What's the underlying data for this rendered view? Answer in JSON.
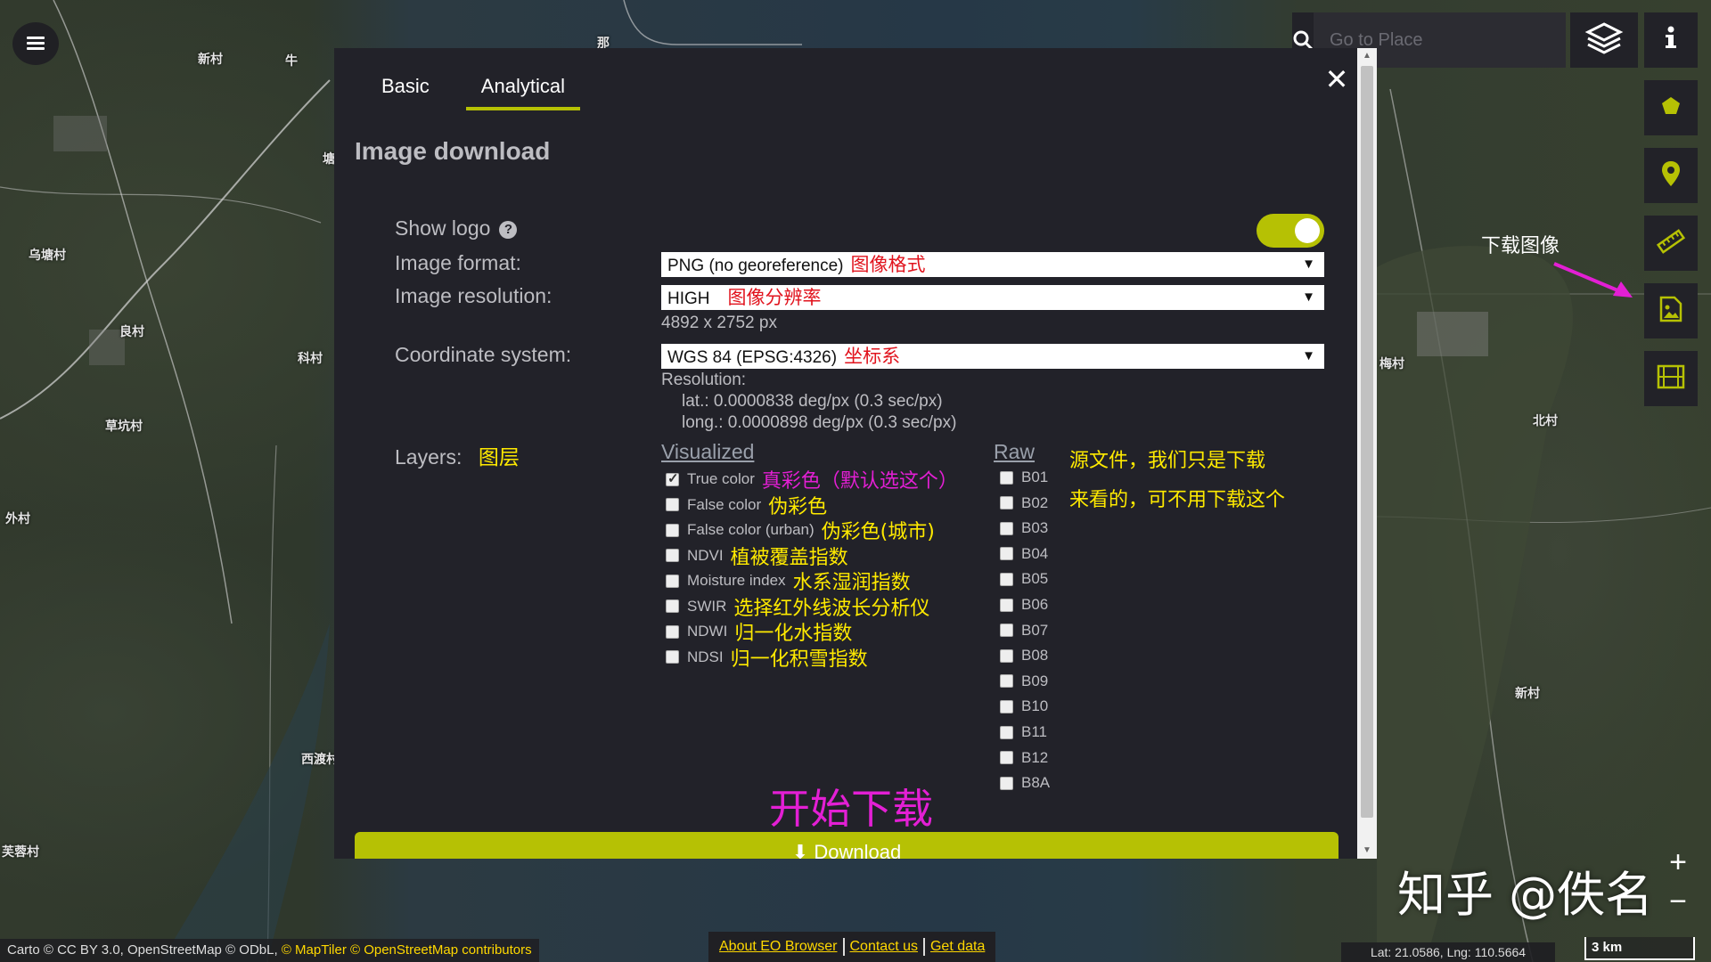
{
  "map": {
    "places": [
      "新村",
      "牛",
      "那",
      "塘",
      "北村",
      "新村",
      "乌塘村",
      "良村",
      "科村",
      "草坑村",
      "外村",
      "西渡村",
      "芙蓉村",
      "梅村"
    ]
  },
  "search": {
    "placeholder": "Go to Place"
  },
  "modal": {
    "tabs": [
      "Basic",
      "Analytical"
    ],
    "active_tab": "Analytical",
    "title": "Image download",
    "show_logo_label": "Show logo",
    "show_logo_enabled": true,
    "image_format_label": "Image format:",
    "image_format_value": "PNG (no georeference)",
    "image_format_note": "图像格式",
    "image_resolution_label": "Image resolution:",
    "image_resolution_value": "HIGH",
    "image_resolution_note": "图像分辨率",
    "image_size": "4892 x 2752 px",
    "coordinate_system_label": "Coordinate system:",
    "coordinate_system_value": "WGS 84 (EPSG:4326)",
    "coordinate_system_note": "坐标系",
    "resolution_label": "Resolution:",
    "resolution_lat": "lat.: 0.0000838 deg/px (0.3 sec/px)",
    "resolution_long": "long.: 0.0000898 deg/px (0.3 sec/px)",
    "layers_label": "Layers:",
    "layers_note": "图层",
    "visualized_header": "Visualized",
    "raw_header": "Raw",
    "visualized": [
      {
        "label": "True color",
        "note": "真彩色（默认选这个）",
        "checked": true,
        "note_color": "#e31fd4"
      },
      {
        "label": "False color",
        "note": "伪彩色",
        "checked": false,
        "note_color": "#ffea00"
      },
      {
        "label": "False color (urban)",
        "note": "伪彩色(城市)",
        "checked": false,
        "note_color": "#ffea00"
      },
      {
        "label": "NDVI",
        "note": "植被覆盖指数",
        "checked": false,
        "note_color": "#ffea00"
      },
      {
        "label": "Moisture index",
        "note": "水系湿润指数",
        "checked": false,
        "note_color": "#ffea00"
      },
      {
        "label": "SWIR",
        "note": "选择红外线波长分析仪",
        "checked": false,
        "note_color": "#ffea00"
      },
      {
        "label": "NDWI",
        "note": "归一化水指数",
        "checked": false,
        "note_color": "#ffea00"
      },
      {
        "label": "NDSI",
        "note": "归一化积雪指数",
        "checked": false,
        "note_color": "#ffea00"
      }
    ],
    "raw": [
      "B01",
      "B02",
      "B03",
      "B04",
      "B05",
      "B06",
      "B07",
      "B08",
      "B09",
      "B10",
      "B11",
      "B12",
      "B8A"
    ],
    "raw_note_line1": "源文件，我们只是下载",
    "raw_note_line2": "来看的，可不用下载这个",
    "start_download_note": "开始下载",
    "download_button": "Download"
  },
  "annotations": {
    "download_image": "下载图像"
  },
  "attribution": {
    "plain": "Carto © CC BY 3.0, OpenStreetMap © ODbL,",
    "highlight": "© MapTiler © OpenStreetMap contributors"
  },
  "links": [
    "About EO Browser",
    "Contact us",
    "Get data"
  ],
  "coordinates": "Lat: 21.0586, Lng: 110.5664",
  "scale": "3 km",
  "watermark": "知乎 @佚名",
  "colors": {
    "accent": "#b6c104",
    "panel": "#222229",
    "annot_magenta": "#e31fd4",
    "annot_yellow": "#ffea00",
    "annot_red": "#e1131d"
  }
}
